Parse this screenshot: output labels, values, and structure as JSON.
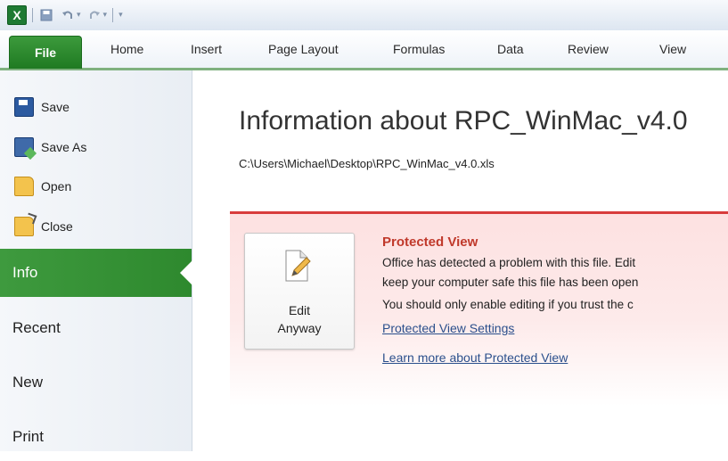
{
  "app": {
    "icon_label": "X"
  },
  "quick_access": {
    "icons": [
      "excel-icon",
      "save-icon",
      "undo-icon",
      "redo-icon",
      "customize-icon"
    ]
  },
  "tabs": [
    "File",
    "Home",
    "Insert",
    "Page Layout",
    "Formulas",
    "Data",
    "Review",
    "View"
  ],
  "backstage": {
    "commands": [
      "Save",
      "Save As",
      "Open",
      "Close"
    ],
    "nav": [
      "Info",
      "Recent",
      "New",
      "Print"
    ],
    "active": "Info"
  },
  "info": {
    "title": "Information about RPC_WinMac_v4.0",
    "path": "C:\\Users\\Michael\\Desktop\\RPC_WinMac_v4.0.xls"
  },
  "protected_view": {
    "button_line1": "Edit",
    "button_line2": "Anyway",
    "heading": "Protected View",
    "line1": "Office has detected a problem with this file. Edit",
    "line2": "keep your computer safe this file has been open",
    "line3": "You should only enable editing if you trust the c",
    "link1": "Protected View Settings",
    "link2": "Learn more about Protected View"
  },
  "colors": {
    "file_tab": "#2e892e",
    "active_nav": "#3e9a3e",
    "alert_border": "#d83c3c",
    "alert_heading": "#c0392b",
    "link": "#2b4f8c"
  }
}
